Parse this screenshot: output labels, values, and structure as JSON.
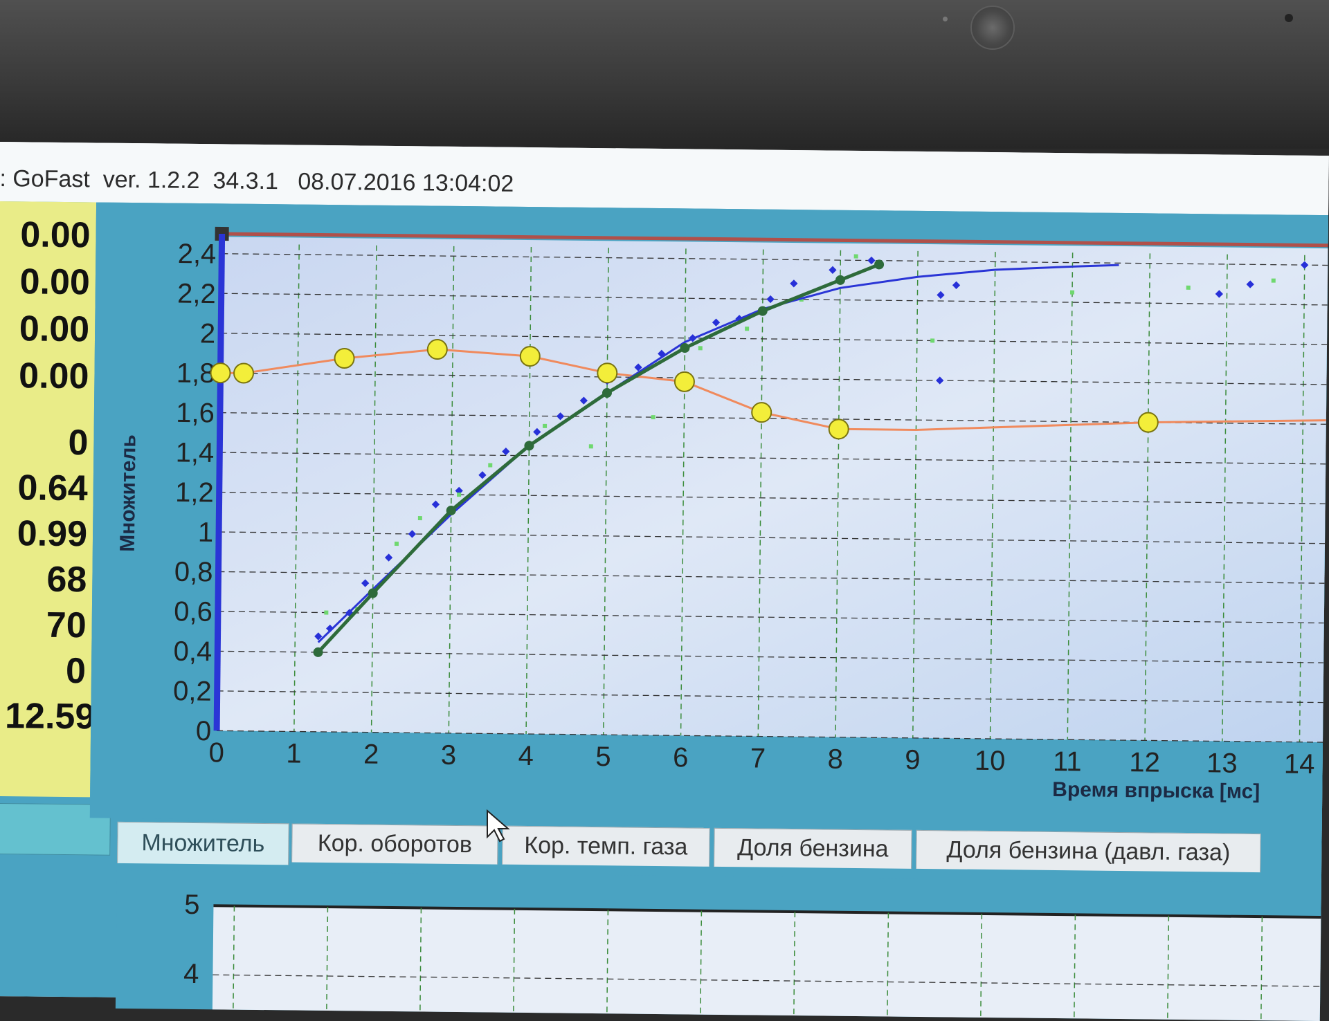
{
  "window": {
    "title": ": GoFast  ver. 1.2.2  34.3.1   08.07.2016 13:04:02"
  },
  "readouts": [
    "0.00",
    "0.00",
    "0.00",
    "0.00",
    "0",
    "0.64",
    "0.99",
    "68",
    "70",
    "0",
    "12.59"
  ],
  "tabs": [
    {
      "label": "Множитель",
      "active": true
    },
    {
      "label": "Кор. оборотов",
      "active": false
    },
    {
      "label": "Кор. темп. газа",
      "active": false
    },
    {
      "label": "Доля бензина",
      "active": false
    },
    {
      "label": "Доля бензина (давл. газа)",
      "active": false
    }
  ],
  "colors": {
    "orange_curve": "#f08a5d",
    "blue_curve": "#2a35d6",
    "green_curve": "#2e6b3a",
    "points": "#f3ee3a",
    "limit_line": "#b0504a",
    "cursor_line": "#2a35d6"
  },
  "chart_data": {
    "type": "line",
    "xlabel": "Время впрыска [мс]",
    "ylabel": "Множитель",
    "xlim": [
      0,
      14.3
    ],
    "ylim": [
      0,
      2.45
    ],
    "x_ticks": [
      "0",
      "1",
      "2",
      "3",
      "4",
      "5",
      "6",
      "7",
      "8",
      "9",
      "10",
      "11",
      "12",
      "13",
      "14"
    ],
    "y_ticks": [
      "0",
      "0,2",
      "0,4",
      "0,6",
      "0,8",
      "1",
      "1,2",
      "1,4",
      "1,6",
      "1,8",
      "2",
      "2,2",
      "2,4"
    ],
    "grid": true,
    "upper_limit": 2.5,
    "cursor_x": 0,
    "series": [
      {
        "role": "orange",
        "x": [
          0,
          0.3,
          1.6,
          2.8,
          4.0,
          5.0,
          6.0,
          7.0,
          8.0,
          9.0,
          12.0,
          14.3
        ],
        "y": [
          1.8,
          1.8,
          1.88,
          1.93,
          1.9,
          1.82,
          1.78,
          1.63,
          1.55,
          1.55,
          1.6,
          1.62
        ]
      },
      {
        "role": "blue",
        "x": [
          1.3,
          2.0,
          3.0,
          4.0,
          5.0,
          6.0,
          7.0,
          8.0,
          9.0,
          10.0,
          11.0,
          11.6
        ],
        "y": [
          0.45,
          0.72,
          1.1,
          1.45,
          1.72,
          1.98,
          2.15,
          2.26,
          2.32,
          2.36,
          2.38,
          2.39
        ]
      },
      {
        "role": "green",
        "x": [
          1.3,
          2.0,
          3.0,
          4.0,
          5.0,
          6.0,
          7.0,
          8.0,
          8.5
        ],
        "y": [
          0.4,
          0.7,
          1.12,
          1.45,
          1.72,
          1.95,
          2.14,
          2.3,
          2.38
        ]
      }
    ],
    "control_points": {
      "x": [
        0,
        0.3,
        1.6,
        2.8,
        4.0,
        5.0,
        6.0,
        7.0,
        8.0,
        12.0
      ],
      "y": [
        1.8,
        1.8,
        1.88,
        1.93,
        1.9,
        1.82,
        1.78,
        1.63,
        1.55,
        1.6
      ]
    },
    "scatter_blue": {
      "x": [
        1.3,
        1.45,
        1.7,
        1.9,
        2.2,
        2.5,
        2.8,
        3.1,
        3.4,
        3.7,
        4.1,
        4.4,
        4.7,
        5.0,
        5.4,
        5.7,
        6.1,
        6.4,
        6.7,
        7.1,
        7.4,
        7.9,
        8.4,
        9.3,
        9.5,
        12.9,
        13.3,
        14.0,
        9.3
      ],
      "y": [
        0.48,
        0.52,
        0.6,
        0.75,
        0.88,
        1.0,
        1.15,
        1.22,
        1.3,
        1.42,
        1.52,
        1.6,
        1.68,
        1.78,
        1.85,
        1.92,
        2.0,
        2.08,
        2.1,
        2.2,
        2.28,
        2.35,
        2.4,
        2.23,
        2.28,
        2.25,
        2.3,
        2.4,
        1.8
      ]
    },
    "scatter_green": {
      "x": [
        1.4,
        1.8,
        2.3,
        2.6,
        3.1,
        3.5,
        4.2,
        4.8,
        5.6,
        6.2,
        6.8,
        7.5,
        8.2,
        9.2,
        11.0,
        12.5,
        13.6
      ],
      "y": [
        0.6,
        0.62,
        0.95,
        1.08,
        1.2,
        1.35,
        1.55,
        1.45,
        1.6,
        1.95,
        2.05,
        2.2,
        2.42,
        2.0,
        2.25,
        2.28,
        2.32
      ]
    },
    "bottom_panel": {
      "y_ticks": [
        "5",
        "4"
      ]
    }
  }
}
